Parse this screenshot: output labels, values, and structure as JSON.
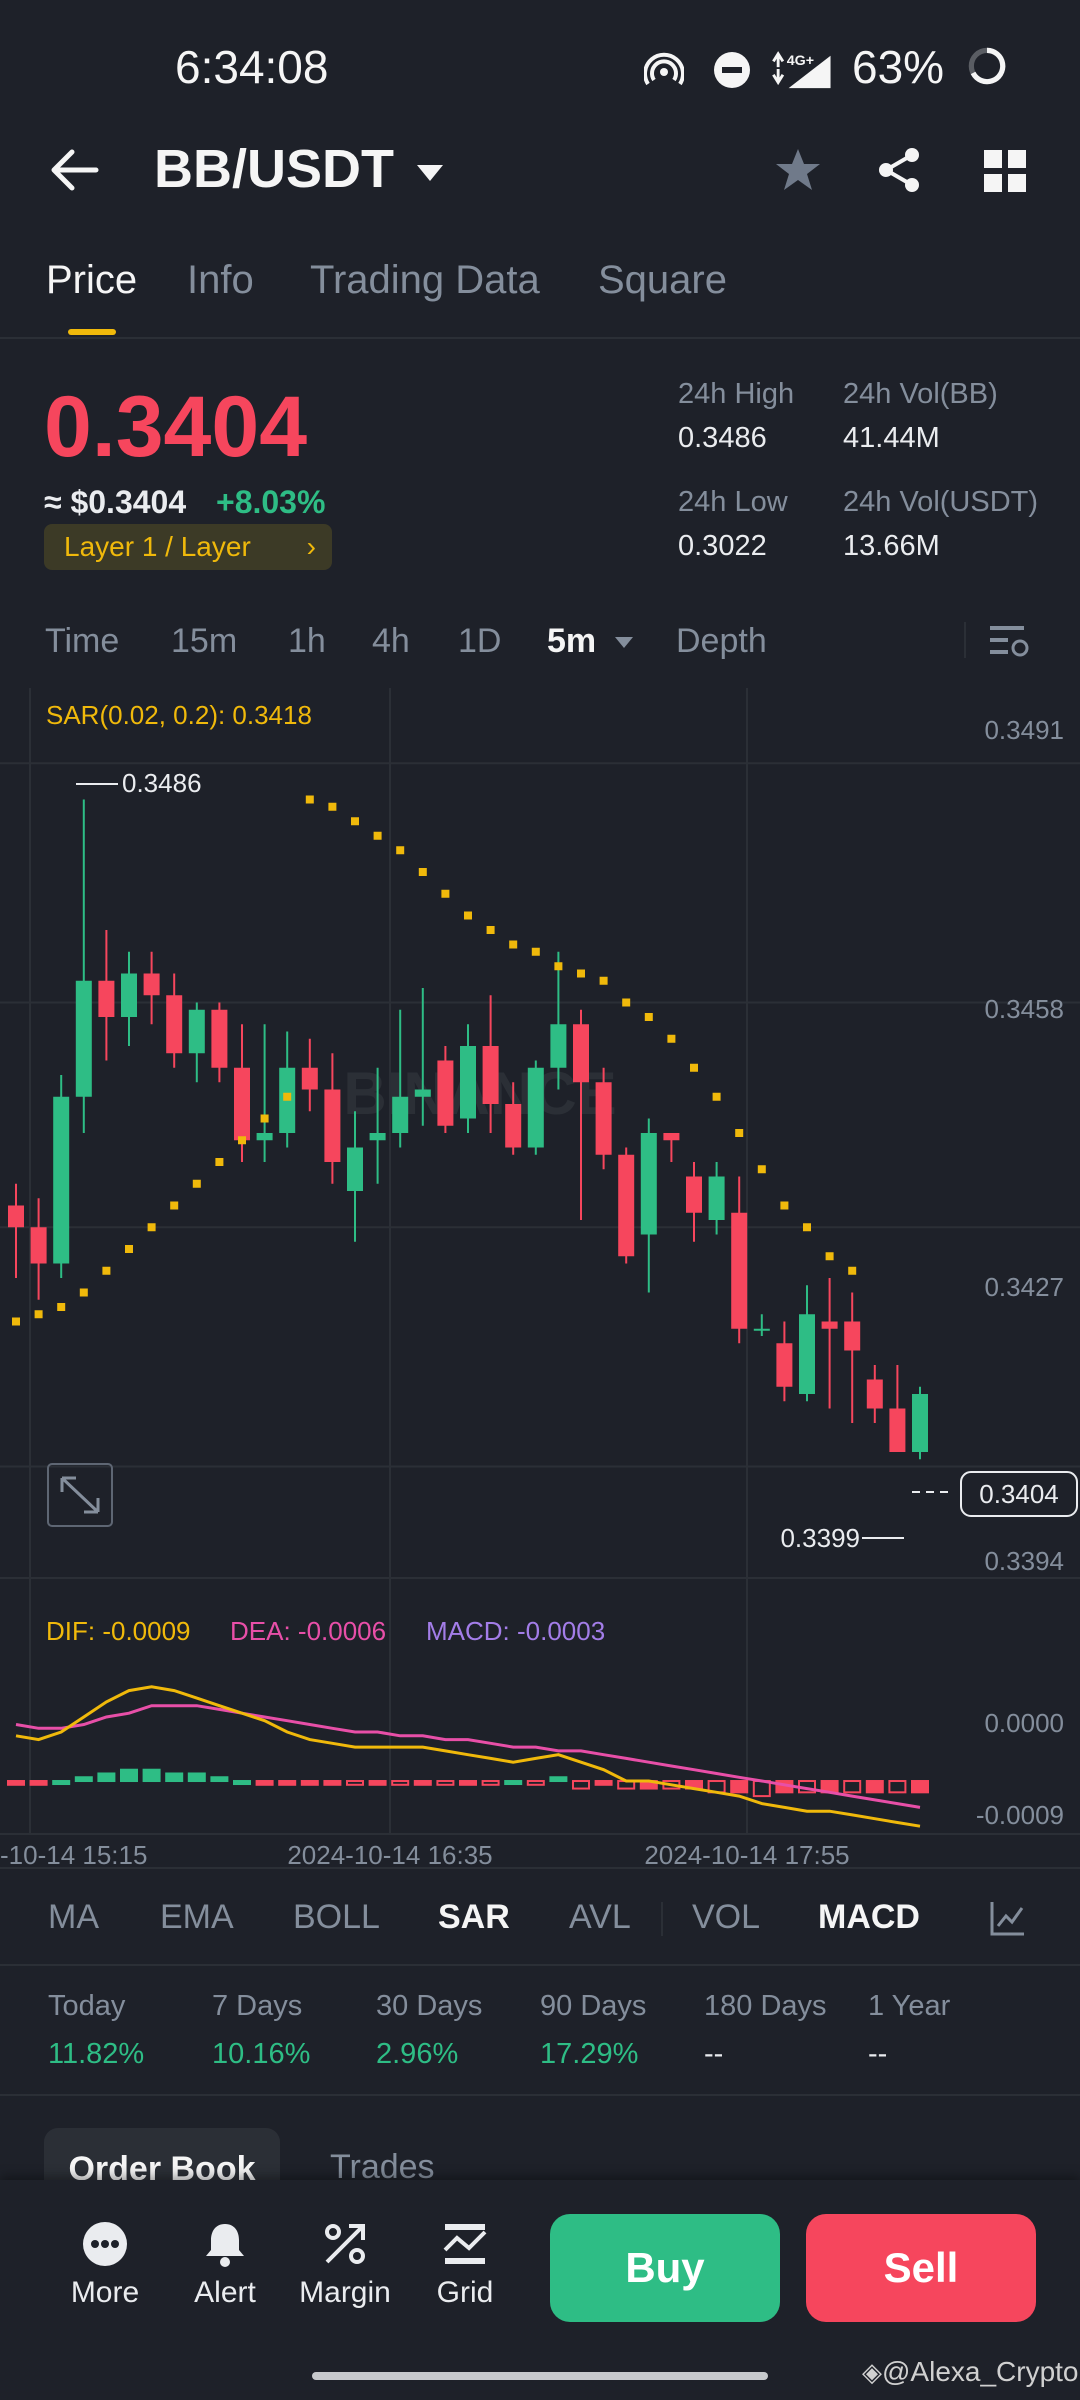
{
  "status_bar": {
    "time": "6:34:08",
    "battery": "63%",
    "network": "4G+"
  },
  "header": {
    "pair": "BB/USDT"
  },
  "tabs": [
    {
      "label": "Price",
      "active": true
    },
    {
      "label": "Info"
    },
    {
      "label": "Trading Data"
    },
    {
      "label": "Square"
    }
  ],
  "price": {
    "last": "0.3404",
    "usd": "≈ $0.3404",
    "change": "+8.03%",
    "category": "Layer 1 / Layer"
  },
  "stats": {
    "high_label": "24h High",
    "high_value": "0.3486",
    "low_label": "24h Low",
    "low_value": "0.3022",
    "vol_base_label": "24h Vol(BB)",
    "vol_base_value": "41.44M",
    "vol_quote_label": "24h Vol(USDT)",
    "vol_quote_value": "13.66M"
  },
  "timeframes": [
    "Time",
    "15m",
    "1h",
    "4h",
    "1D",
    "5m",
    "Depth"
  ],
  "active_timeframe": "5m",
  "chart": {
    "sar_label": "SAR(0.02, 0.2): 0.3418",
    "price_axis": [
      "0.3491",
      "0.3458",
      "0.3427",
      "0.3394"
    ],
    "high_marker": "0.3486",
    "low_marker": "0.3399",
    "current_price_tag": "0.3404",
    "watermark": "BINANCE",
    "macd_dif": "DIF: -0.0009",
    "macd_dea": "DEA: -0.0006",
    "macd_value": "MACD: -0.0003",
    "macd_axis": [
      "0.0000",
      "-0.0009"
    ],
    "time_axis": [
      "-10-14 15:15",
      "2024-10-14 16:35",
      "2024-10-14 17:55"
    ]
  },
  "colors": {
    "up": "#2ebd85",
    "down": "#f6465d",
    "accent": "#f0b90b",
    "background": "#1e2129"
  },
  "indicators": [
    "MA",
    "EMA",
    "BOLL",
    "SAR",
    "AVL",
    "VOL",
    "MACD"
  ],
  "active_indicators": [
    "SAR",
    "MACD"
  ],
  "performance": [
    {
      "label": "Today",
      "value": "11.82%"
    },
    {
      "label": "7 Days",
      "value": "10.16%"
    },
    {
      "label": "30 Days",
      "value": "2.96%"
    },
    {
      "label": "90 Days",
      "value": "17.29%"
    },
    {
      "label": "180 Days",
      "value": "--"
    },
    {
      "label": "1 Year",
      "value": "--"
    }
  ],
  "book_tabs": {
    "order_book": "Order Book",
    "trades": "Trades"
  },
  "bottom_bar": {
    "more": "More",
    "alert": "Alert",
    "margin": "Margin",
    "grid": "Grid",
    "buy": "Buy",
    "sell": "Sell"
  },
  "watermark_credit": "@Alexa_Crypto",
  "chart_data": {
    "type": "candlestick",
    "y_range": [
      0.338,
      0.35
    ],
    "price_ticks": [
      0.3491,
      0.3458,
      0.3427,
      0.3394
    ],
    "candles": [
      {
        "o": 0.343,
        "h": 0.3433,
        "l": 0.342,
        "c": 0.3427
      },
      {
        "o": 0.3427,
        "h": 0.3431,
        "l": 0.3417,
        "c": 0.3422
      },
      {
        "o": 0.3422,
        "h": 0.3448,
        "l": 0.342,
        "c": 0.3445
      },
      {
        "o": 0.3445,
        "h": 0.3486,
        "l": 0.344,
        "c": 0.3461
      },
      {
        "o": 0.3461,
        "h": 0.3468,
        "l": 0.345,
        "c": 0.3456
      },
      {
        "o": 0.3456,
        "h": 0.3465,
        "l": 0.3452,
        "c": 0.3462
      },
      {
        "o": 0.3462,
        "h": 0.3465,
        "l": 0.3455,
        "c": 0.3459
      },
      {
        "o": 0.3459,
        "h": 0.3462,
        "l": 0.3449,
        "c": 0.3451
      },
      {
        "o": 0.3451,
        "h": 0.3458,
        "l": 0.3447,
        "c": 0.3457
      },
      {
        "o": 0.3457,
        "h": 0.3458,
        "l": 0.3447,
        "c": 0.3449
      },
      {
        "o": 0.3449,
        "h": 0.3455,
        "l": 0.3436,
        "c": 0.3439
      },
      {
        "o": 0.3439,
        "h": 0.3455,
        "l": 0.3436,
        "c": 0.344
      },
      {
        "o": 0.344,
        "h": 0.3454,
        "l": 0.3438,
        "c": 0.3449
      },
      {
        "o": 0.3449,
        "h": 0.3453,
        "l": 0.3443,
        "c": 0.3446
      },
      {
        "o": 0.3446,
        "h": 0.3451,
        "l": 0.3433,
        "c": 0.3436
      },
      {
        "o": 0.3432,
        "h": 0.3443,
        "l": 0.3425,
        "c": 0.3438
      },
      {
        "o": 0.3439,
        "h": 0.3449,
        "l": 0.3433,
        "c": 0.344
      },
      {
        "o": 0.344,
        "h": 0.3457,
        "l": 0.3438,
        "c": 0.3445
      },
      {
        "o": 0.3445,
        "h": 0.346,
        "l": 0.3441,
        "c": 0.3446
      },
      {
        "o": 0.345,
        "h": 0.3452,
        "l": 0.344,
        "c": 0.3441
      },
      {
        "o": 0.3442,
        "h": 0.3455,
        "l": 0.344,
        "c": 0.3452
      },
      {
        "o": 0.3452,
        "h": 0.3459,
        "l": 0.344,
        "c": 0.3444
      },
      {
        "o": 0.3444,
        "h": 0.3447,
        "l": 0.3437,
        "c": 0.3438
      },
      {
        "o": 0.3438,
        "h": 0.345,
        "l": 0.3437,
        "c": 0.3449
      },
      {
        "o": 0.3449,
        "h": 0.3465,
        "l": 0.3446,
        "c": 0.3455
      },
      {
        "o": 0.3455,
        "h": 0.3457,
        "l": 0.3428,
        "c": 0.3447
      },
      {
        "o": 0.3447,
        "h": 0.3449,
        "l": 0.3435,
        "c": 0.3437
      },
      {
        "o": 0.3437,
        "h": 0.3438,
        "l": 0.3422,
        "c": 0.3423
      },
      {
        "o": 0.3426,
        "h": 0.3442,
        "l": 0.3418,
        "c": 0.344
      },
      {
        "o": 0.344,
        "h": 0.344,
        "l": 0.3436,
        "c": 0.3439
      },
      {
        "o": 0.3434,
        "h": 0.3436,
        "l": 0.3425,
        "c": 0.3429
      },
      {
        "o": 0.3428,
        "h": 0.3436,
        "l": 0.3426,
        "c": 0.3434
      },
      {
        "o": 0.3429,
        "h": 0.3434,
        "l": 0.3411,
        "c": 0.3413
      },
      {
        "o": 0.3413,
        "h": 0.3415,
        "l": 0.3412,
        "c": 0.3413
      },
      {
        "o": 0.3411,
        "h": 0.3414,
        "l": 0.3403,
        "c": 0.3405
      },
      {
        "o": 0.3404,
        "h": 0.3419,
        "l": 0.3403,
        "c": 0.3415
      },
      {
        "o": 0.3414,
        "h": 0.342,
        "l": 0.3402,
        "c": 0.3413
      },
      {
        "o": 0.3414,
        "h": 0.3418,
        "l": 0.34,
        "c": 0.341
      },
      {
        "o": 0.3406,
        "h": 0.3408,
        "l": 0.34,
        "c": 0.3402
      },
      {
        "o": 0.3402,
        "h": 0.3408,
        "l": 0.3399,
        "c": 0.3396
      },
      {
        "o": 0.3396,
        "h": 0.3405,
        "l": 0.3395,
        "c": 0.3404
      }
    ],
    "sar": [
      0.3414,
      0.3415,
      0.3416,
      0.3418,
      0.3421,
      0.3424,
      0.3427,
      0.343,
      0.3433,
      0.3436,
      0.3439,
      0.3442,
      0.3445,
      0.3486,
      0.3485,
      0.3483,
      0.3481,
      0.3479,
      0.3476,
      0.3473,
      0.347,
      0.3468,
      0.3466,
      0.3465,
      0.3463,
      0.3462,
      0.3461,
      0.3458,
      0.3456,
      0.3453,
      0.3449,
      0.3445,
      0.344,
      0.3435,
      0.343,
      0.3427,
      0.3423,
      0.3421
    ],
    "macd": {
      "histogram": [
        -0.0001,
        -0.0001,
        0.0,
        0.0001,
        0.0002,
        0.0003,
        0.0003,
        0.0002,
        0.0002,
        0.0001,
        0.0,
        -0.0001,
        -0.0001,
        -0.0001,
        -0.0001,
        -0.0001,
        -0.0001,
        -0.0001,
        -0.0001,
        -0.0001,
        -0.0001,
        -0.0001,
        0.0,
        -0.0001,
        0.0001,
        -0.0002,
        -0.0001,
        -0.0002,
        -0.0002,
        -0.0002,
        -0.0002,
        -0.0003,
        -0.0003,
        -0.0004,
        -0.0003,
        -0.0003,
        -0.0003,
        -0.0003,
        -0.0003,
        -0.0003,
        -0.0003
      ],
      "dif": [
        0.0012,
        0.0011,
        0.0013,
        0.0017,
        0.0021,
        0.0024,
        0.0025,
        0.0024,
        0.0022,
        0.002,
        0.0018,
        0.0016,
        0.0013,
        0.0011,
        0.001,
        0.0009,
        0.0009,
        0.0009,
        0.0009,
        0.0008,
        0.0007,
        0.0006,
        0.0005,
        0.0006,
        0.0007,
        0.0005,
        0.0003,
        0.0,
        0.0,
        -0.0001,
        -0.0002,
        -0.0003,
        -0.0004,
        -0.0006,
        -0.0007,
        -0.0008,
        -0.0008,
        -0.0009,
        -0.001,
        -0.0011,
        -0.0012
      ],
      "dea": [
        0.0015,
        0.0014,
        0.0014,
        0.0015,
        0.0017,
        0.0018,
        0.002,
        0.002,
        0.002,
        0.0019,
        0.0018,
        0.0017,
        0.0016,
        0.0015,
        0.0014,
        0.0013,
        0.0013,
        0.0012,
        0.0012,
        0.0011,
        0.0011,
        0.001,
        0.0009,
        0.0009,
        0.0008,
        0.0008,
        0.0007,
        0.0006,
        0.0005,
        0.0004,
        0.0003,
        0.0002,
        0.0001,
        0.0,
        -0.0001,
        -0.0002,
        -0.0003,
        -0.0004,
        -0.0005,
        -0.0006,
        -0.0007
      ],
      "y_range": [
        -0.0013,
        0.003
      ]
    }
  }
}
